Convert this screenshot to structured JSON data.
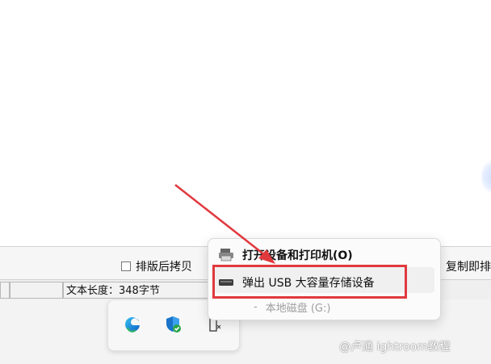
{
  "toolbar": {
    "checkbox_label": "排版后拷贝",
    "right_truncated_label": "复制即排"
  },
  "status": {
    "text_length": "文本长度：348字节"
  },
  "context_menu": {
    "item_open_devices": "打开设备和打印机(O)",
    "item_eject_usb": "弹出 USB 大容量存储设备",
    "item_local_disk_prefix": "-",
    "item_local_disk": "本地磁盘 (G:)"
  },
  "watermark": {
    "text": "@卢通  ightroom教程"
  },
  "colors": {
    "annotation_red": "#e0393e",
    "taskbar_bg": "#f3f3f3",
    "menu_bg": "#fbfbfb"
  },
  "icons": {
    "printer": "printer-icon",
    "usb_drive": "usb-drive-icon",
    "edge": "edge-browser-icon",
    "defender": "windows-security-icon",
    "usb_tray": "usb-eject-tray-icon"
  }
}
